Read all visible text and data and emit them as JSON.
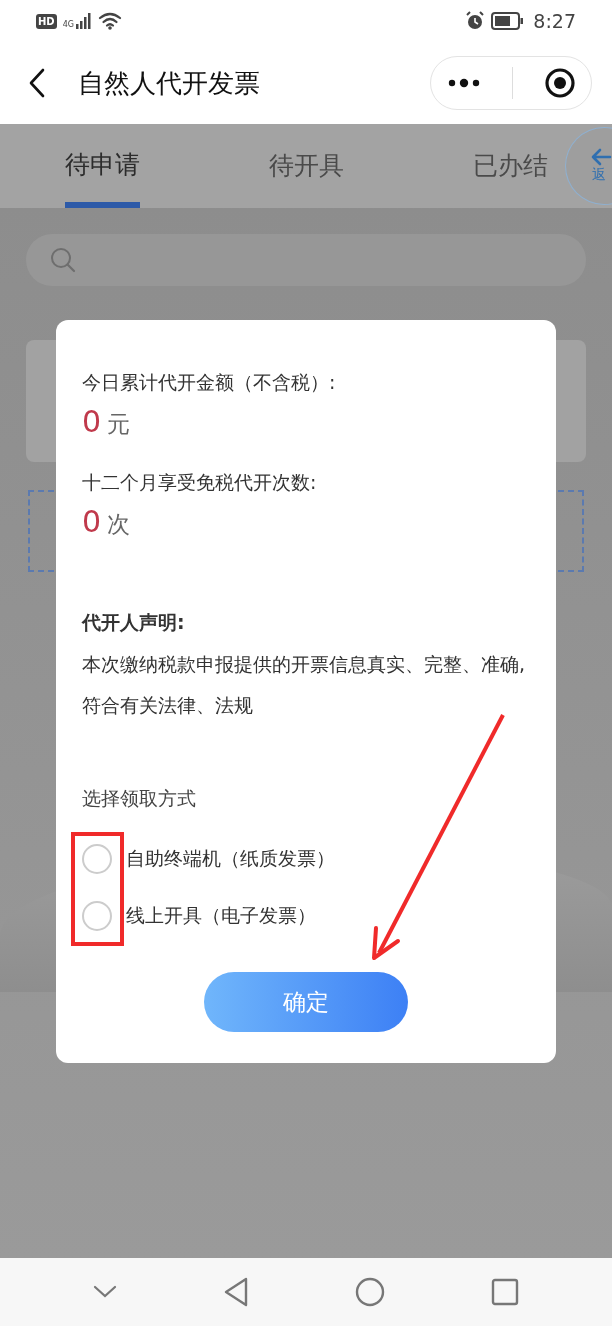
{
  "status_bar": {
    "hd": "HD",
    "network": "4G",
    "time": "8:27"
  },
  "nav_bar": {
    "title": "自然人代开发票"
  },
  "tabs": [
    {
      "label": "待申请",
      "selected": true
    },
    {
      "label": "待开具",
      "selected": false
    },
    {
      "label": "已办结",
      "selected": false
    }
  ],
  "float_button": {
    "label": "返"
  },
  "dialog": {
    "amount_label": "今日累计代开金额（不含税）:",
    "amount_value": "0",
    "amount_unit": "元",
    "count_label": "十二个月享受免税代开次数:",
    "count_value": "0",
    "count_unit": "次",
    "declaration_title": "代开人声明:",
    "declaration_text": "本次缴纳税款申报提供的开票信息真实、完整、准确,符合有关法律、法规",
    "pickup_label": "选择领取方式",
    "options": [
      {
        "label": "自助终端机（纸质发票）",
        "selected": false
      },
      {
        "label": "线上开具（电子发票）",
        "selected": false
      }
    ],
    "confirm_button": "确定"
  },
  "annotations": [
    {
      "kind": "box"
    },
    {
      "kind": "arrow"
    }
  ]
}
